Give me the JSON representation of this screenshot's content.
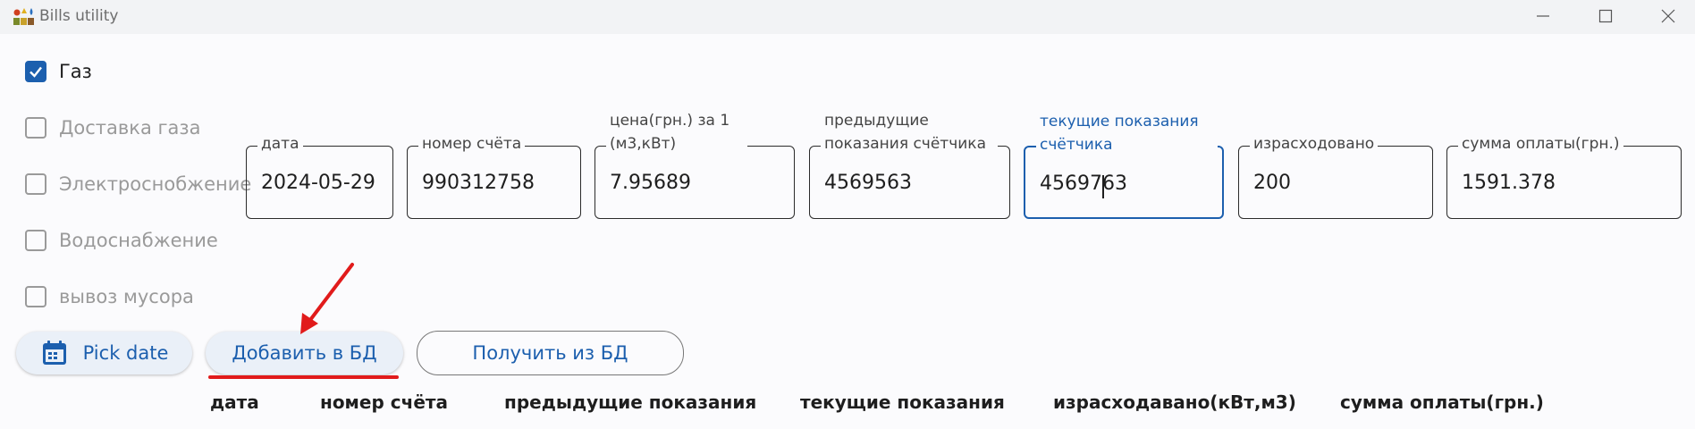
{
  "window": {
    "title": "Bills utility",
    "controls": [
      "minimize",
      "maximize",
      "close"
    ]
  },
  "checkboxes": [
    {
      "label": "Газ",
      "checked": true
    },
    {
      "label": "Доставка газа",
      "checked": false
    },
    {
      "label": "Электроснобжение",
      "checked": false
    },
    {
      "label": "Водоснабжение",
      "checked": false
    },
    {
      "label": "вывоз мусора",
      "checked": false
    }
  ],
  "fields": [
    {
      "label": "дата",
      "value": "2024-05-29"
    },
    {
      "label": "номер счёта",
      "value": "990312758"
    },
    {
      "label": "цена(грн.) за 1 (м3,кВт)",
      "value": "7.95689"
    },
    {
      "label": "предыдущие показания счётчика",
      "value": "4569563"
    },
    {
      "label": "текущие показания счётчика",
      "value": "4569763",
      "focused": true
    },
    {
      "label": "израсходовано",
      "value": "200"
    },
    {
      "label": "сумма оплаты(грн.)",
      "value": "1591.378"
    }
  ],
  "buttons": {
    "pick_date": "Pick date",
    "add_db": "Добавить в БД",
    "get_db": "Получить из БД"
  },
  "table_headers": [
    "дата",
    "номер счёта",
    "предыдущие показания",
    "текущие показания",
    "израсходавано(кВт,м3)",
    "сумма оплаты(грн.)"
  ],
  "colors": {
    "accent": "#1c5fae",
    "annotation": "#e11b1b"
  }
}
